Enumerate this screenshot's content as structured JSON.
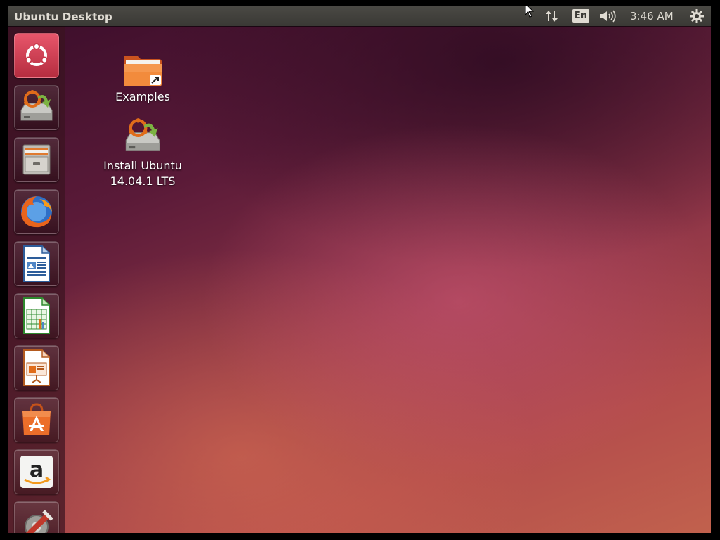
{
  "panel": {
    "title": "Ubuntu Desktop",
    "keyboard_layout": "En",
    "clock": "3:46 AM",
    "icons": [
      "network-icon",
      "volume-icon",
      "session-gear-icon"
    ]
  },
  "launcher": {
    "items": [
      {
        "name": "dash-home",
        "icon": "ubuntu-logo-icon"
      },
      {
        "name": "install-ubuntu",
        "icon": "installer-disk-icon"
      },
      {
        "name": "files",
        "icon": "file-cabinet-icon"
      },
      {
        "name": "firefox",
        "icon": "firefox-icon"
      },
      {
        "name": "libreoffice-writer",
        "icon": "writer-document-icon"
      },
      {
        "name": "libreoffice-calc",
        "icon": "calc-spreadsheet-icon"
      },
      {
        "name": "libreoffice-impress",
        "icon": "impress-presentation-icon"
      },
      {
        "name": "ubuntu-software-center",
        "icon": "shopping-bag-icon"
      },
      {
        "name": "amazon",
        "icon": "amazon-icon"
      },
      {
        "name": "system-settings",
        "icon": "settings-tools-icon"
      }
    ]
  },
  "desktop": {
    "icons": [
      {
        "label": "Examples",
        "icon": "folder-link-icon"
      },
      {
        "label": "Install Ubuntu 14.04.1 LTS",
        "label_line1": "Install Ubuntu",
        "label_line2": "14.04.1 LTS",
        "icon": "installer-disk-icon"
      }
    ]
  },
  "colors": {
    "panel_bg": "#3c3b37",
    "panel_text": "#dfdbd2",
    "launcher_bg": "#3a1420",
    "wallpaper_dark": "#3a0d2a",
    "wallpaper_light": "#c1614d",
    "ubuntu_orange": "#dd4814"
  }
}
